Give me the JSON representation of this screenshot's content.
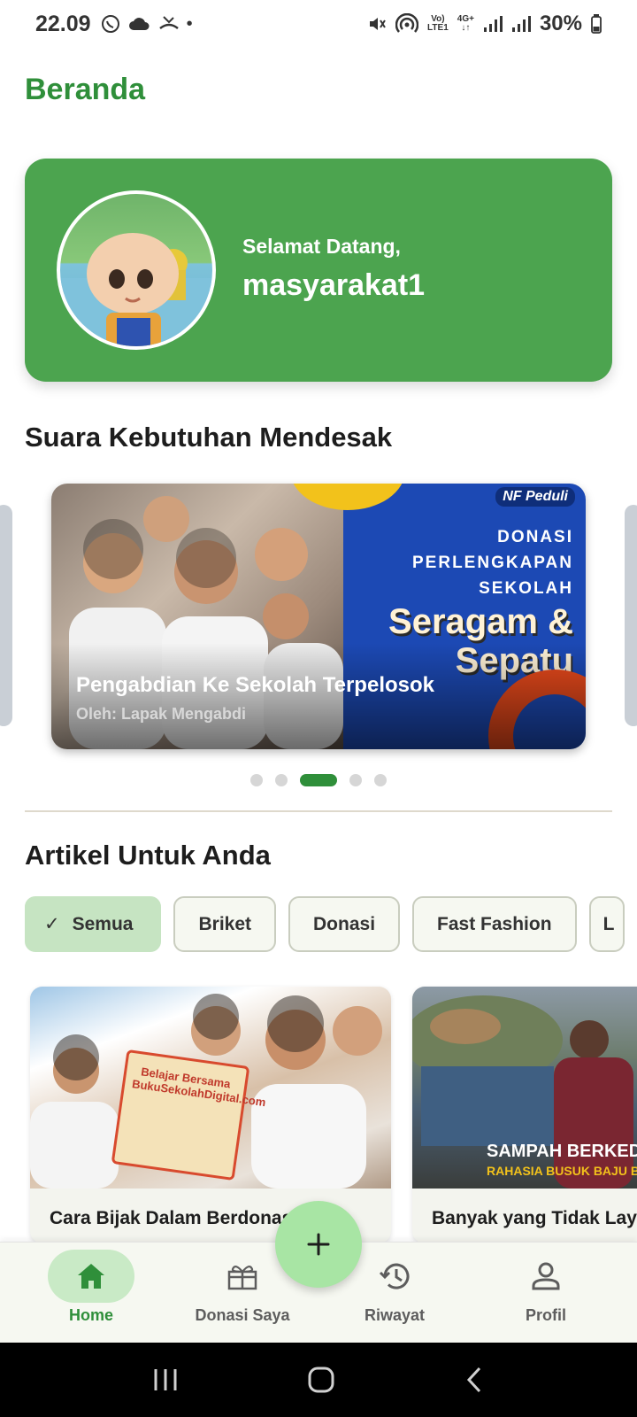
{
  "status_bar": {
    "time": "22.09",
    "network_top": "Vo)",
    "network_bottom": "LTE1",
    "network2_top": "4G+",
    "network2_bottom": "↓↑",
    "battery": "30%",
    "icons": [
      "whatsapp-icon",
      "cloud-icon",
      "missed-call-icon",
      "dot-icon",
      "mute-icon",
      "hotspot-icon",
      "signal-icon",
      "signal-icon",
      "battery-icon"
    ]
  },
  "header": {
    "title": "Beranda"
  },
  "welcome": {
    "greeting": "Selamat Datang,",
    "username": "masyarakat1"
  },
  "urgent": {
    "title": "Suara Kebutuhan Mendesak",
    "card": {
      "title": "Pengabdian Ke Sekolah Terpelosok",
      "author": "Oleh: Lapak Mengabdi",
      "poster_logo": "NF Peduli",
      "poster_subtitle": "DONASI PERLENGKAPAN SEKOLAH",
      "poster_headline": "Seragam & Sepatu"
    },
    "active_slide": 3,
    "total_slides": 5
  },
  "articles": {
    "title": "Artikel Untuk Anda",
    "chips": [
      "Semua",
      "Briket",
      "Donasi",
      "Fast Fashion",
      "L"
    ],
    "selected_chip": "Semua",
    "items": [
      {
        "title": "Cara Bijak Dalam Berdonasi",
        "image_text": "Belajar Bersama BukuSekolahDigital.com"
      },
      {
        "title": "Banyak yang Tidak Layak",
        "image_caption": "SAMPAH BERKEDOK",
        "image_subcaption": "RAHASIA BUSUK BAJU BEKAS"
      }
    ]
  },
  "fab": {
    "icon": "plus-icon"
  },
  "bottom_nav": {
    "items": [
      {
        "label": "Home",
        "icon": "home-icon",
        "active": true
      },
      {
        "label": "Donasi Saya",
        "icon": "gift-icon",
        "active": false
      },
      {
        "label": "Riwayat",
        "icon": "history-icon",
        "active": false
      },
      {
        "label": "Profil",
        "icon": "person-icon",
        "active": false
      }
    ]
  },
  "colors": {
    "primary": "#2f8f3a",
    "card_green": "#4ca44f",
    "chip_selected": "#c6e4c2",
    "fab": "#a8e5a4"
  }
}
